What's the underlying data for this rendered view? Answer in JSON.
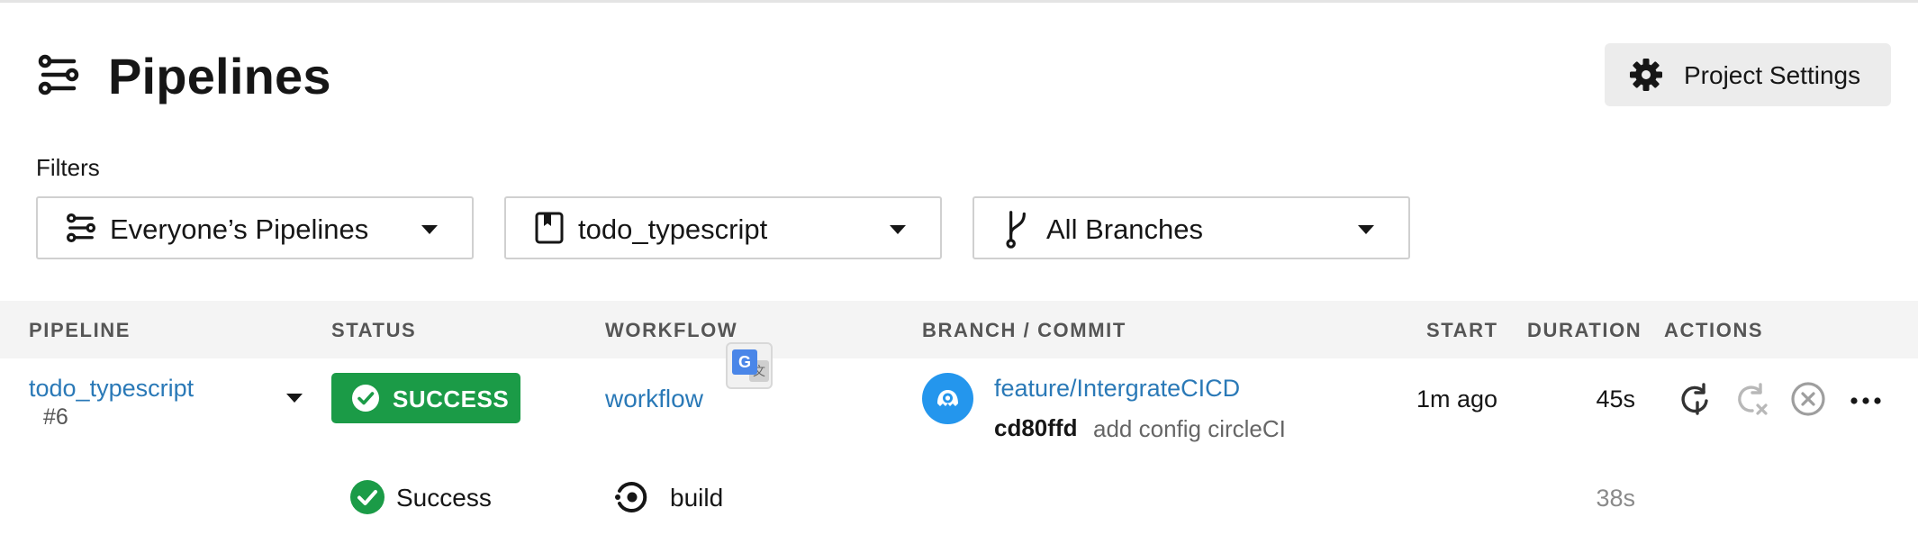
{
  "header": {
    "title": "Pipelines",
    "settings_label": "Project Settings",
    "icons": {
      "page": "pipelines-icon",
      "settings": "gear-icon"
    }
  },
  "filters": {
    "label": "Filters",
    "items": [
      {
        "label": "Everyone’s Pipelines",
        "icon": "pipelines-icon"
      },
      {
        "label": "todo_typescript",
        "icon": "bookmark-icon"
      },
      {
        "label": "All Branches",
        "icon": "branch-icon"
      }
    ]
  },
  "table": {
    "columns": [
      "PIPELINE",
      "STATUS",
      "WORKFLOW",
      "BRANCH / COMMIT",
      "START",
      "DURATION",
      "ACTIONS"
    ],
    "rows": [
      {
        "pipeline": "todo_typescript",
        "number": "#6",
        "status": "SUCCESS",
        "workflow": "workflow",
        "branch": "feature/IntergrateCICD",
        "commit_hash": "cd80ffd",
        "commit_message": "add config circleCI",
        "start": "1m ago",
        "duration": "45s",
        "jobs": [
          {
            "status": "Success",
            "name": "build",
            "duration": "38s"
          }
        ]
      }
    ]
  },
  "colors": {
    "success": "#1b9b47",
    "link": "#2a79b7",
    "header_bg": "#f4f4f4",
    "settings_bg": "#ececec"
  }
}
